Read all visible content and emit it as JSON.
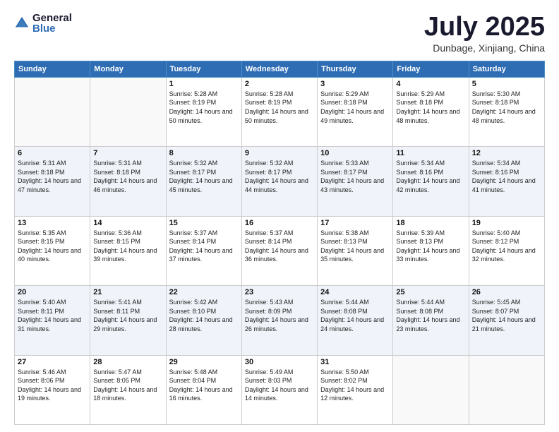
{
  "logo": {
    "general": "General",
    "blue": "Blue"
  },
  "title": {
    "month": "July 2025",
    "location": "Dunbage, Xinjiang, China"
  },
  "weekdays": [
    "Sunday",
    "Monday",
    "Tuesday",
    "Wednesday",
    "Thursday",
    "Friday",
    "Saturday"
  ],
  "weeks": [
    [
      {
        "day": "",
        "sunrise": "",
        "sunset": "",
        "daylight": ""
      },
      {
        "day": "",
        "sunrise": "",
        "sunset": "",
        "daylight": ""
      },
      {
        "day": "1",
        "sunrise": "Sunrise: 5:28 AM",
        "sunset": "Sunset: 8:19 PM",
        "daylight": "Daylight: 14 hours and 50 minutes."
      },
      {
        "day": "2",
        "sunrise": "Sunrise: 5:28 AM",
        "sunset": "Sunset: 8:19 PM",
        "daylight": "Daylight: 14 hours and 50 minutes."
      },
      {
        "day": "3",
        "sunrise": "Sunrise: 5:29 AM",
        "sunset": "Sunset: 8:18 PM",
        "daylight": "Daylight: 14 hours and 49 minutes."
      },
      {
        "day": "4",
        "sunrise": "Sunrise: 5:29 AM",
        "sunset": "Sunset: 8:18 PM",
        "daylight": "Daylight: 14 hours and 48 minutes."
      },
      {
        "day": "5",
        "sunrise": "Sunrise: 5:30 AM",
        "sunset": "Sunset: 8:18 PM",
        "daylight": "Daylight: 14 hours and 48 minutes."
      }
    ],
    [
      {
        "day": "6",
        "sunrise": "Sunrise: 5:31 AM",
        "sunset": "Sunset: 8:18 PM",
        "daylight": "Daylight: 14 hours and 47 minutes."
      },
      {
        "day": "7",
        "sunrise": "Sunrise: 5:31 AM",
        "sunset": "Sunset: 8:18 PM",
        "daylight": "Daylight: 14 hours and 46 minutes."
      },
      {
        "day": "8",
        "sunrise": "Sunrise: 5:32 AM",
        "sunset": "Sunset: 8:17 PM",
        "daylight": "Daylight: 14 hours and 45 minutes."
      },
      {
        "day": "9",
        "sunrise": "Sunrise: 5:32 AM",
        "sunset": "Sunset: 8:17 PM",
        "daylight": "Daylight: 14 hours and 44 minutes."
      },
      {
        "day": "10",
        "sunrise": "Sunrise: 5:33 AM",
        "sunset": "Sunset: 8:17 PM",
        "daylight": "Daylight: 14 hours and 43 minutes."
      },
      {
        "day": "11",
        "sunrise": "Sunrise: 5:34 AM",
        "sunset": "Sunset: 8:16 PM",
        "daylight": "Daylight: 14 hours and 42 minutes."
      },
      {
        "day": "12",
        "sunrise": "Sunrise: 5:34 AM",
        "sunset": "Sunset: 8:16 PM",
        "daylight": "Daylight: 14 hours and 41 minutes."
      }
    ],
    [
      {
        "day": "13",
        "sunrise": "Sunrise: 5:35 AM",
        "sunset": "Sunset: 8:15 PM",
        "daylight": "Daylight: 14 hours and 40 minutes."
      },
      {
        "day": "14",
        "sunrise": "Sunrise: 5:36 AM",
        "sunset": "Sunset: 8:15 PM",
        "daylight": "Daylight: 14 hours and 39 minutes."
      },
      {
        "day": "15",
        "sunrise": "Sunrise: 5:37 AM",
        "sunset": "Sunset: 8:14 PM",
        "daylight": "Daylight: 14 hours and 37 minutes."
      },
      {
        "day": "16",
        "sunrise": "Sunrise: 5:37 AM",
        "sunset": "Sunset: 8:14 PM",
        "daylight": "Daylight: 14 hours and 36 minutes."
      },
      {
        "day": "17",
        "sunrise": "Sunrise: 5:38 AM",
        "sunset": "Sunset: 8:13 PM",
        "daylight": "Daylight: 14 hours and 35 minutes."
      },
      {
        "day": "18",
        "sunrise": "Sunrise: 5:39 AM",
        "sunset": "Sunset: 8:13 PM",
        "daylight": "Daylight: 14 hours and 33 minutes."
      },
      {
        "day": "19",
        "sunrise": "Sunrise: 5:40 AM",
        "sunset": "Sunset: 8:12 PM",
        "daylight": "Daylight: 14 hours and 32 minutes."
      }
    ],
    [
      {
        "day": "20",
        "sunrise": "Sunrise: 5:40 AM",
        "sunset": "Sunset: 8:11 PM",
        "daylight": "Daylight: 14 hours and 31 minutes."
      },
      {
        "day": "21",
        "sunrise": "Sunrise: 5:41 AM",
        "sunset": "Sunset: 8:11 PM",
        "daylight": "Daylight: 14 hours and 29 minutes."
      },
      {
        "day": "22",
        "sunrise": "Sunrise: 5:42 AM",
        "sunset": "Sunset: 8:10 PM",
        "daylight": "Daylight: 14 hours and 28 minutes."
      },
      {
        "day": "23",
        "sunrise": "Sunrise: 5:43 AM",
        "sunset": "Sunset: 8:09 PM",
        "daylight": "Daylight: 14 hours and 26 minutes."
      },
      {
        "day": "24",
        "sunrise": "Sunrise: 5:44 AM",
        "sunset": "Sunset: 8:08 PM",
        "daylight": "Daylight: 14 hours and 24 minutes."
      },
      {
        "day": "25",
        "sunrise": "Sunrise: 5:44 AM",
        "sunset": "Sunset: 8:08 PM",
        "daylight": "Daylight: 14 hours and 23 minutes."
      },
      {
        "day": "26",
        "sunrise": "Sunrise: 5:45 AM",
        "sunset": "Sunset: 8:07 PM",
        "daylight": "Daylight: 14 hours and 21 minutes."
      }
    ],
    [
      {
        "day": "27",
        "sunrise": "Sunrise: 5:46 AM",
        "sunset": "Sunset: 8:06 PM",
        "daylight": "Daylight: 14 hours and 19 minutes."
      },
      {
        "day": "28",
        "sunrise": "Sunrise: 5:47 AM",
        "sunset": "Sunset: 8:05 PM",
        "daylight": "Daylight: 14 hours and 18 minutes."
      },
      {
        "day": "29",
        "sunrise": "Sunrise: 5:48 AM",
        "sunset": "Sunset: 8:04 PM",
        "daylight": "Daylight: 14 hours and 16 minutes."
      },
      {
        "day": "30",
        "sunrise": "Sunrise: 5:49 AM",
        "sunset": "Sunset: 8:03 PM",
        "daylight": "Daylight: 14 hours and 14 minutes."
      },
      {
        "day": "31",
        "sunrise": "Sunrise: 5:50 AM",
        "sunset": "Sunset: 8:02 PM",
        "daylight": "Daylight: 14 hours and 12 minutes."
      },
      {
        "day": "",
        "sunrise": "",
        "sunset": "",
        "daylight": ""
      },
      {
        "day": "",
        "sunrise": "",
        "sunset": "",
        "daylight": ""
      }
    ]
  ]
}
